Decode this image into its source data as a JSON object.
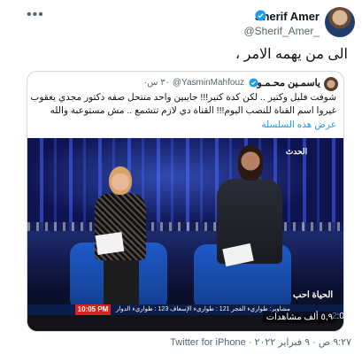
{
  "header": {
    "author_name": "Sherif Amer",
    "author_handle": "@Sherif_Amer_",
    "more_label": "•••"
  },
  "tweet": {
    "text": "الى من يهمه الامر ،"
  },
  "quote": {
    "name": "ياسمـين محـمـود",
    "handle": "@YasminMahfouz",
    "time": "٣٠ س·",
    "line1": "شوفت فليل وكتير .. لكن كدة كتير!!! جايبين واحد منتحل صفه دكتور مجدي يعقوب ؟!!!",
    "line2": "غيروا اسم القناة للنصب اليوم!!! القناة دي لازم تتشمع .. مش مستوعبة والله",
    "show_thread": "عرض هذه السلسلة"
  },
  "video": {
    "channel_logo": "الحدث",
    "ticker_time": "10:05 PM",
    "ticker_text": "مشاوير: طواريء الفجر 121 : طواريء الإسعاف 123 : طواريء الدوار",
    "ticker_logo": "الحياة احب",
    "views": "٥,٩ ألف مشاهدات",
    "duration": "2:03"
  },
  "footer": {
    "timestamp": "٩:٢٧ ص · ٩ فبراير ٢٠٢٢ · Twitter for iPhone"
  },
  "colors": {
    "accent": "#1d9bf0",
    "muted": "#536471",
    "verified": "#1d9bf0"
  }
}
